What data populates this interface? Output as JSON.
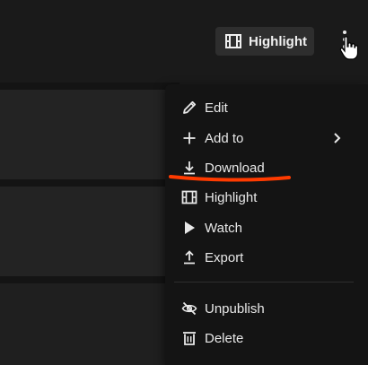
{
  "toolbar": {
    "highlight_label": "Highlight",
    "more_icon": "vertical-ellipsis-icon"
  },
  "menu": {
    "items": [
      {
        "label": "Edit",
        "icon": "pencil-icon"
      },
      {
        "label": "Add to",
        "icon": "plus-icon",
        "submenu": true
      },
      {
        "label": "Download",
        "icon": "download-icon"
      },
      {
        "label": "Highlight",
        "icon": "film-icon"
      },
      {
        "label": "Watch",
        "icon": "play-icon"
      },
      {
        "label": "Export",
        "icon": "upload-icon"
      },
      {
        "label": "Unpublish",
        "icon": "eye-off-icon"
      },
      {
        "label": "Delete",
        "icon": "trash-icon"
      }
    ]
  },
  "colors": {
    "menu_background": "#141414",
    "annotation_underline": "#ff3b00"
  }
}
